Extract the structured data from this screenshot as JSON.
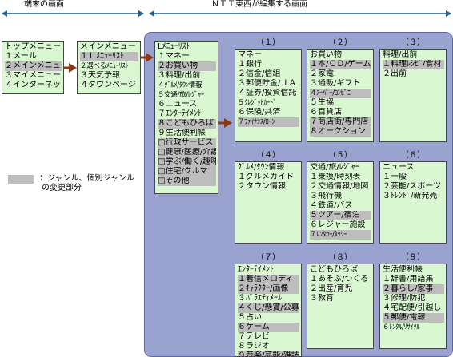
{
  "header": {
    "terminal_screens": "端末の画面",
    "ntt_screens": "ＮＴＴ東西が編集する画面"
  },
  "top_menu": {
    "title": "トップメニュー",
    "items": [
      {
        "label": "１メール",
        "hl": false
      },
      {
        "label": "２メインメニュー",
        "hl": true
      },
      {
        "label": "３マイメニュー",
        "hl": false
      },
      {
        "label": "４インターネット",
        "hl": false
      }
    ]
  },
  "main_menu": {
    "title": "メインメニュー",
    "items": [
      {
        "label": "１Ｌﾒﾆｭｰﾘｽﾄ",
        "hl": true
      },
      {
        "label": "２選べるﾒﾆｭｰﾘｽﾄ",
        "hl": false
      },
      {
        "label": "３天気予報",
        "hl": false
      },
      {
        "label": "４タウンページ",
        "hl": false
      }
    ]
  },
  "l_menu": {
    "title": "Lﾒﾆｭｰﾘｽﾄ",
    "items": [
      {
        "label": "１マネー",
        "hl": false
      },
      {
        "label": "２お買い物",
        "hl": true
      },
      {
        "label": "３料理/出前",
        "hl": false
      },
      {
        "label": "４ｸﾞﾙﾒ/ﾀｳﾝ情報",
        "hl": false
      },
      {
        "label": "５交通/旅/ﾚｼﾞｬｰ",
        "hl": false
      },
      {
        "label": "６ニュース",
        "hl": false
      },
      {
        "label": "７ｴﾝﾀｰﾃｲﾒﾝﾄ",
        "hl": false
      },
      {
        "label": "８こどもひろば",
        "hl": true
      },
      {
        "label": "９生活便利帳",
        "hl": false
      },
      {
        "label": "□行政サービス",
        "hl": true
      },
      {
        "label": "□健康/医療/介護",
        "hl": true
      },
      {
        "label": "□学ぶ/働く/趣味",
        "hl": true
      },
      {
        "label": "□住宅/クルマ",
        "hl": true
      },
      {
        "label": "□その他",
        "hl": true
      }
    ]
  },
  "legend": {
    "line1": "：ジャンル、個別ジャンル",
    "line2": "の変更部分"
  },
  "categories": [
    {
      "num": "（１）",
      "title": "マネー",
      "items": [
        {
          "label": "１銀行",
          "hl": false
        },
        {
          "label": "２信金/信組",
          "hl": false
        },
        {
          "label": "３郵便貯金/ＪＡ",
          "hl": false
        },
        {
          "label": "４証券/投資信託",
          "hl": false
        },
        {
          "label": "５ｸﾚｼﾞｯﾄｶｰﾄﾞ",
          "hl": false
        },
        {
          "label": "６保険/共済",
          "hl": false
        },
        {
          "label": "７ﾌｧｲﾅﾝｽ/ﾛｰﾝ",
          "hl": true
        }
      ]
    },
    {
      "num": "（２）",
      "title": "お買い物",
      "items": [
        {
          "label": "１本/ＣＤ/ゲーム",
          "hl": true
        },
        {
          "label": "２家電",
          "hl": false
        },
        {
          "label": "３通販/ギフト",
          "hl": false
        },
        {
          "label": "４ｽｰﾊﾟｰ/ｺﾝﾋﾞﾆ",
          "hl": true
        },
        {
          "label": "５生協",
          "hl": false
        },
        {
          "label": "６百貨店",
          "hl": false
        },
        {
          "label": "７商店街/専門店",
          "hl": true
        },
        {
          "label": "８オークション",
          "hl": true
        }
      ]
    },
    {
      "num": "（３）",
      "title": "料理/出前",
      "items": [
        {
          "label": "１料理ﾚｼﾋﾟ/食材",
          "hl": true
        },
        {
          "label": "２出前",
          "hl": false
        }
      ]
    },
    {
      "num": "（４）",
      "title": "ｸﾞﾙﾒ/ﾀｳﾝ情報",
      "items": [
        {
          "label": "１グルメガイド",
          "hl": false
        },
        {
          "label": "２タウン情報",
          "hl": false
        }
      ]
    },
    {
      "num": "（５）",
      "title": "交通/旅/ﾚｼﾞｬｰ",
      "items": [
        {
          "label": "１乗換/時刻表",
          "hl": false
        },
        {
          "label": "２交通情報/地図",
          "hl": false
        },
        {
          "label": "３飛行機",
          "hl": false
        },
        {
          "label": "４鉄道/バス",
          "hl": false
        },
        {
          "label": "５ツアー/宿泊",
          "hl": true
        },
        {
          "label": "６レジャー施設",
          "hl": false
        },
        {
          "label": "７ﾚﾝﾀｶｰ/ﾀｸｼｰ",
          "hl": true
        }
      ]
    },
    {
      "num": "（６）",
      "title": "ニュース",
      "items": [
        {
          "label": "１一般",
          "hl": false
        },
        {
          "label": "２芸能/スポーツ",
          "hl": false
        },
        {
          "label": "３ﾄﾚﾝﾄﾞ/新発売",
          "hl": false
        }
      ]
    },
    {
      "num": "（７）",
      "title": "ｴﾝﾀｰﾃｲﾒﾝﾄ",
      "items": [
        {
          "label": "１着信メロディ",
          "hl": true
        },
        {
          "label": "２ｷｬﾗｸﾀｰ/画像",
          "hl": true
        },
        {
          "label": "３ﾊﾞﾗｴﾃｨﾒｰﾙ",
          "hl": false
        },
        {
          "label": "４くじ/懸賞/公募",
          "hl": true
        },
        {
          "label": "５占い",
          "hl": false
        },
        {
          "label": "６ゲーム",
          "hl": true
        },
        {
          "label": "７テレビ",
          "hl": false
        },
        {
          "label": "８ラジオ",
          "hl": false
        },
        {
          "label": "９音楽/芸能/雑誌",
          "hl": true
        }
      ]
    },
    {
      "num": "（８）",
      "title": "こどもひろば",
      "items": [
        {
          "label": "１あそぶ/つくる",
          "hl": false
        },
        {
          "label": "２出産/育児",
          "hl": false
        },
        {
          "label": "３教育",
          "hl": false
        }
      ]
    },
    {
      "num": "（９）",
      "title": "生活便利帳",
      "items": [
        {
          "label": "１辞書/用語集",
          "hl": false
        },
        {
          "label": "２暮らし/家事",
          "hl": true
        },
        {
          "label": "３修理/防犯",
          "hl": false
        },
        {
          "label": "４宅配便/引越し",
          "hl": false
        },
        {
          "label": "５郵便/電報",
          "hl": true
        },
        {
          "label": "６ﾚﾝﾀﾙ/ﾘｻｲｸﾙ",
          "hl": false
        }
      ]
    }
  ],
  "colors": {
    "box_fill": "#d9f7d1",
    "highlight": "#bdbdbd",
    "region_fill": "#9aa2cf",
    "arrow_brown": "#8a3a12",
    "arrow_blue": "#1f5f8b"
  }
}
